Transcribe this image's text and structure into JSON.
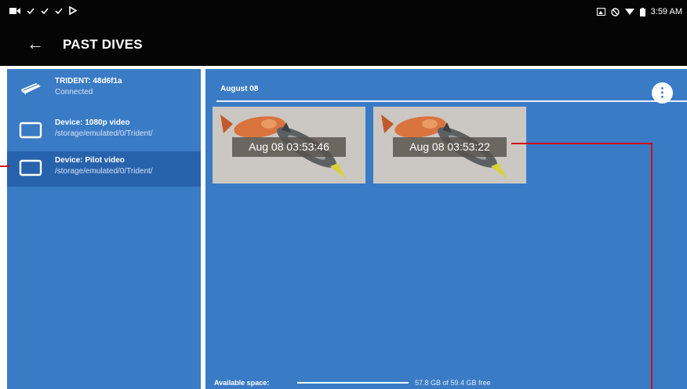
{
  "status_bar": {
    "time": "3:59 AM",
    "left_icons": [
      "video-camera-icon",
      "check-icon",
      "check-icon",
      "check-icon",
      "play-store-icon"
    ],
    "right_icons": [
      "image-icon",
      "do-not-disturb-icon",
      "wifi-icon",
      "battery-icon"
    ]
  },
  "header": {
    "back_label": "←",
    "title": "PAST DIVES"
  },
  "sidebar": {
    "items": [
      {
        "label": "TRIDENT: 48d6f1a",
        "sub": "Connected"
      },
      {
        "label": "Device: 1080p video",
        "sub": "/storage/emulated/0/Trident/"
      },
      {
        "label": "Device: Pilot video",
        "sub": "/storage/emulated/0/Trident/"
      }
    ]
  },
  "main": {
    "section_title": "August 08",
    "menu_label": "⋮",
    "thumbnails": [
      {
        "label": "Aug 08 03:53:46"
      },
      {
        "label": "Aug 08 03:53:22"
      }
    ]
  },
  "storage": {
    "label": "Available space:",
    "usage": "57.8 GB of 59.4 GB free",
    "free_fraction": 0.973
  },
  "colors": {
    "panel": "#3a7bc6",
    "selected": "#2762ad",
    "topbar": "#050505",
    "annotation": "#d10d16"
  }
}
